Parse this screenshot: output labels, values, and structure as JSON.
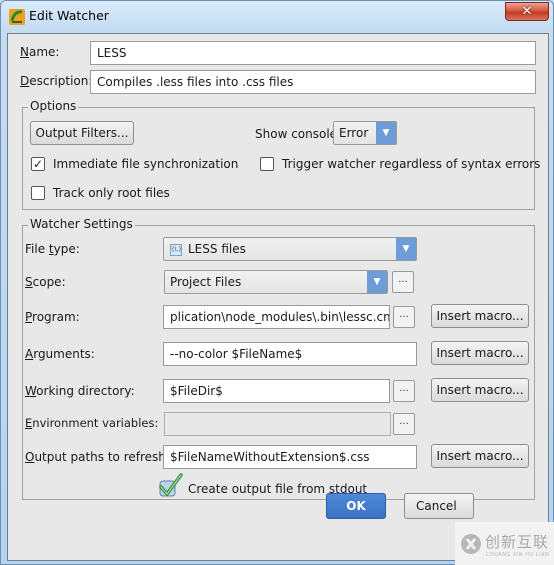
{
  "window": {
    "title": "Edit Watcher",
    "app_icon": "phpstorm-icon",
    "close_label": "x"
  },
  "general": {
    "name_label": "Name:",
    "name_mnemonic": "N",
    "name_value": "LESS",
    "description_label": "Description:",
    "description_value": "Compiles .less files into .css files"
  },
  "options": {
    "title": "Options",
    "output_filters_label": "Output Filters...",
    "show_console_label": "Show console:",
    "show_console_value": "Error",
    "immediate_sync_label": "Immediate file synchronization",
    "immediate_sync_checked": true,
    "trigger_watcher_label": "Trigger watcher regardless of syntax errors",
    "trigger_watcher_checked": false,
    "track_root_label": "Track only root files",
    "track_root_checked": false
  },
  "watcher_settings": {
    "title": "Watcher Settings",
    "file_type_label": "File type:",
    "file_type_value": "LESS files",
    "file_type_icon": "less-file-icon",
    "scope_label": "Scope:",
    "scope_value": "Project Files",
    "program_label": "Program:",
    "program_value": "plication\\node_modules\\.bin\\lessc.cmd",
    "arguments_label": "Arguments:",
    "arguments_value": "--no-color $FileName$",
    "working_dir_label": "Working directory:",
    "working_dir_value": "$FileDir$",
    "env_vars_label": "Environment variables:",
    "env_vars_value": "",
    "output_paths_label": "Output paths to refresh:",
    "output_paths_value": "$FileNameWithoutExtension$.css",
    "insert_macro_label": "Insert macro...",
    "browse_label": "...",
    "create_output_label": "Create output file from stdout",
    "create_output_checked": true
  },
  "footer": {
    "ok_label": "OK",
    "cancel_label": "Cancel"
  },
  "watermark": {
    "text_cn": "创新互联",
    "text_en": "CHUANG XIN HU LIAN"
  }
}
